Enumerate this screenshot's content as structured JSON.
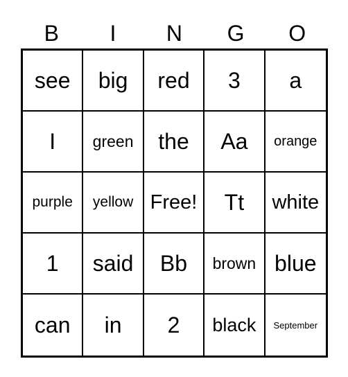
{
  "header": [
    "B",
    "I",
    "N",
    "G",
    "O"
  ],
  "cells": [
    [
      {
        "text": "see",
        "size": 32
      },
      {
        "text": "big",
        "size": 32
      },
      {
        "text": "red",
        "size": 32
      },
      {
        "text": "3",
        "size": 32
      },
      {
        "text": "a",
        "size": 32
      }
    ],
    [
      {
        "text": "I",
        "size": 32
      },
      {
        "text": "green",
        "size": 23
      },
      {
        "text": "the",
        "size": 32
      },
      {
        "text": "Aa",
        "size": 32
      },
      {
        "text": "orange",
        "size": 20
      }
    ],
    [
      {
        "text": "purple",
        "size": 21
      },
      {
        "text": "yellow",
        "size": 21
      },
      {
        "text": "Free!",
        "size": 29
      },
      {
        "text": "Tt",
        "size": 32
      },
      {
        "text": "white",
        "size": 29
      }
    ],
    [
      {
        "text": "1",
        "size": 32
      },
      {
        "text": "said",
        "size": 32
      },
      {
        "text": "Bb",
        "size": 32
      },
      {
        "text": "brown",
        "size": 23
      },
      {
        "text": "blue",
        "size": 32
      }
    ],
    [
      {
        "text": "can",
        "size": 32
      },
      {
        "text": "in",
        "size": 32
      },
      {
        "text": "2",
        "size": 32
      },
      {
        "text": "black",
        "size": 27
      },
      {
        "text": "September",
        "size": 13
      }
    ]
  ]
}
